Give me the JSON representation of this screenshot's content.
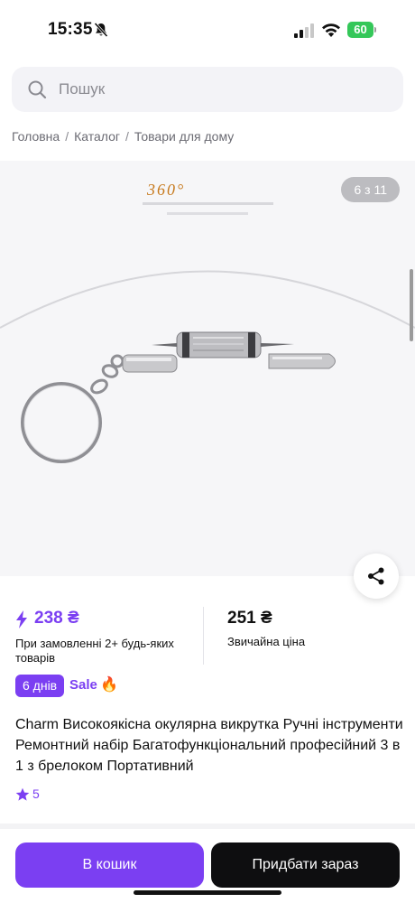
{
  "status_bar": {
    "time": "15:35",
    "battery_level": "60",
    "icons": [
      "bell-slash-icon",
      "signal-icon",
      "wifi-icon",
      "battery-icon"
    ]
  },
  "search": {
    "placeholder": "Пошук",
    "icon": "search-icon"
  },
  "breadcrumb": {
    "items": [
      "Головна",
      "Каталог",
      "Товари для дому"
    ],
    "separator": "/"
  },
  "gallery": {
    "counter": "6 з 11",
    "image_badge": "360°"
  },
  "prices": {
    "promo_price": "238 ₴",
    "promo_note": "При замовленні 2+ будь-яких товарів",
    "regular_price": "251 ₴",
    "regular_note": "Звичайна ціна"
  },
  "badges": {
    "days": "6 днів",
    "sale": "Sale",
    "fire": "🔥"
  },
  "product": {
    "title": "Charm Високоякісна окулярна викрутка Ручні інструменти Ремонтний набір Багатофункціональний професійний 3 в 1 з брелоком Портативний",
    "rating": "5"
  },
  "actions": {
    "add_to_cart": "В кошик",
    "buy_now": "Придбати зараз"
  },
  "colors": {
    "accent": "#7b3ff2",
    "buy_button": "#0e0e10",
    "battery": "#34c759"
  }
}
